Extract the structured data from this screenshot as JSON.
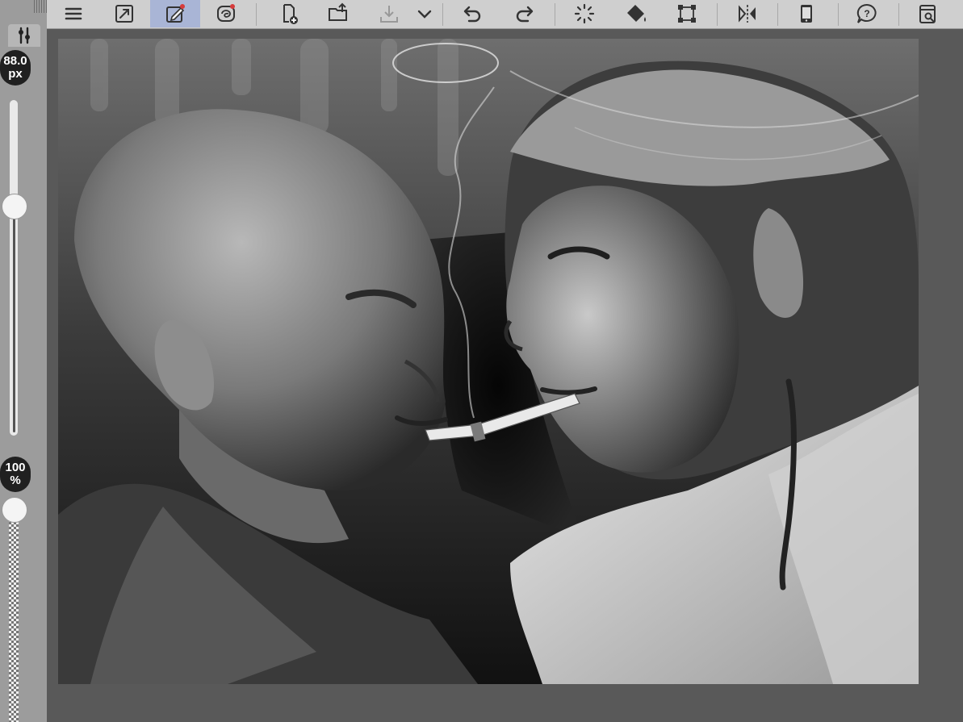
{
  "brush": {
    "size_value": "88.0",
    "size_unit": "px",
    "opacity_value": "100",
    "opacity_unit": "%",
    "size_slider_fraction": 0.32,
    "opacity_slider_fraction": 1.0
  },
  "toolbar": {
    "items": [
      {
        "name": "menu-icon",
        "active": false
      },
      {
        "name": "expand-icon",
        "active": false
      },
      {
        "name": "edit-pen-icon",
        "active": true
      },
      {
        "name": "swirl-layer-icon",
        "active": false
      },
      {
        "name": "new-file-icon",
        "active": false
      },
      {
        "name": "open-folder-icon",
        "active": false
      },
      {
        "name": "save-icon",
        "active": false
      },
      {
        "name": "chevron-down-icon",
        "active": false
      },
      {
        "name": "undo-icon",
        "active": false
      },
      {
        "name": "redo-icon",
        "active": false
      },
      {
        "name": "loading-spinner-icon",
        "active": false
      },
      {
        "name": "fill-bucket-icon",
        "active": false
      },
      {
        "name": "transform-select-icon",
        "active": false
      },
      {
        "name": "flip-horizontal-icon",
        "active": false
      },
      {
        "name": "smartphone-icon",
        "active": false
      },
      {
        "name": "help-icon",
        "active": false
      },
      {
        "name": "settings-document-icon",
        "active": false
      }
    ]
  },
  "colors": {
    "toolbar_bg": "#cfcfcf",
    "active_tool_bg": "#a9b5d6",
    "panel_bg": "#9c9c9c",
    "canvas_bg": "#595959"
  }
}
